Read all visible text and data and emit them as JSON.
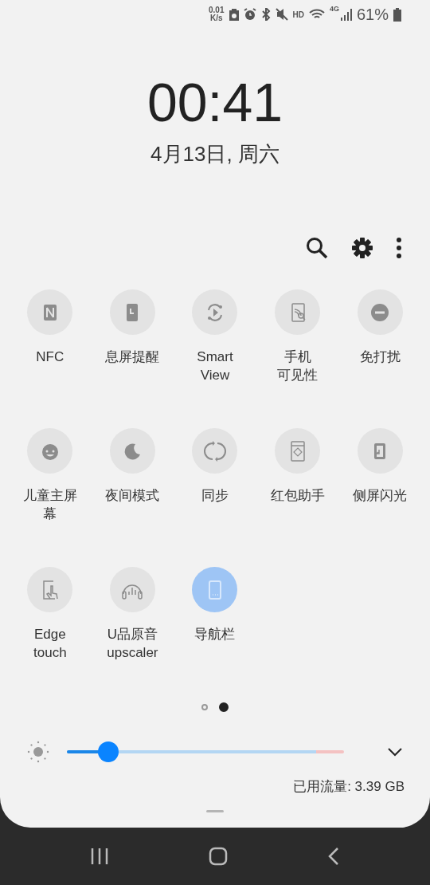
{
  "status_bar": {
    "net_speed": "0.01",
    "net_unit": "K/s",
    "hd": "HD",
    "network": "4G",
    "battery": "61%"
  },
  "clock": {
    "time": "00:41",
    "date": "4月13日, 周六"
  },
  "tiles": [
    {
      "label": "NFC",
      "on": false
    },
    {
      "label": "息屏提醒",
      "on": false
    },
    {
      "label": "Smart View",
      "on": false
    },
    {
      "label": [
        "手机",
        "可见性"
      ],
      "on": false
    },
    {
      "label": "免打扰",
      "on": false
    },
    {
      "label": "儿童主屏幕",
      "on": false
    },
    {
      "label": "夜间模式",
      "on": false
    },
    {
      "label": "同步",
      "on": false
    },
    {
      "label": "红包助手",
      "on": false
    },
    {
      "label": "侧屏闪光",
      "on": false
    },
    {
      "label": "Edge touch",
      "on": false
    },
    {
      "label": "U品原音 upscaler",
      "on": false
    },
    {
      "label": "导航栏",
      "on": true
    }
  ],
  "page_dots": [
    {
      "selected": false
    },
    {
      "selected": true
    }
  ],
  "brightness": {
    "level": 0.15
  },
  "data_usage": "已用流量: 3.39 GB"
}
